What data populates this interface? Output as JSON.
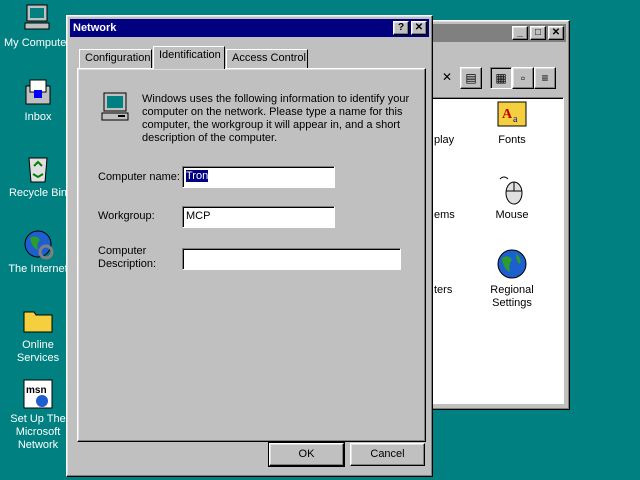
{
  "desktop": {
    "icons": [
      {
        "label": "My Computer"
      },
      {
        "label": "Inbox"
      },
      {
        "label": "Recycle Bin"
      },
      {
        "label": "The Internet"
      },
      {
        "label": "Online Services"
      },
      {
        "label": "Set Up The Microsoft Network"
      }
    ]
  },
  "control_panel": {
    "items": [
      {
        "label": "Fonts"
      },
      {
        "label": "Mouse"
      },
      {
        "label": "Regional Settings"
      }
    ],
    "partial_labels": [
      "play",
      "ems",
      "ters"
    ]
  },
  "dialog": {
    "title": "Network",
    "help_button": "?",
    "close_button": "✕",
    "tabs": [
      {
        "label": "Configuration"
      },
      {
        "label": "Identification"
      },
      {
        "label": "Access Control"
      }
    ],
    "info_text": "Windows uses the following information to identify your computer on the network.  Please type a name for this computer, the workgroup it will appear in, and a short description of the computer.",
    "computer_name_label": "Computer name:",
    "computer_name_value": "Tron",
    "workgroup_label": "Workgroup:",
    "workgroup_value": "MCP",
    "description_label_1": "Computer",
    "description_label_2": "Description:",
    "description_value": "",
    "ok_label": "OK",
    "cancel_label": "Cancel"
  },
  "colors": {
    "desktop": "#008080",
    "titlebar_active": "#000080",
    "titlebar_inactive": "#808080",
    "face": "#c0c0c0"
  }
}
